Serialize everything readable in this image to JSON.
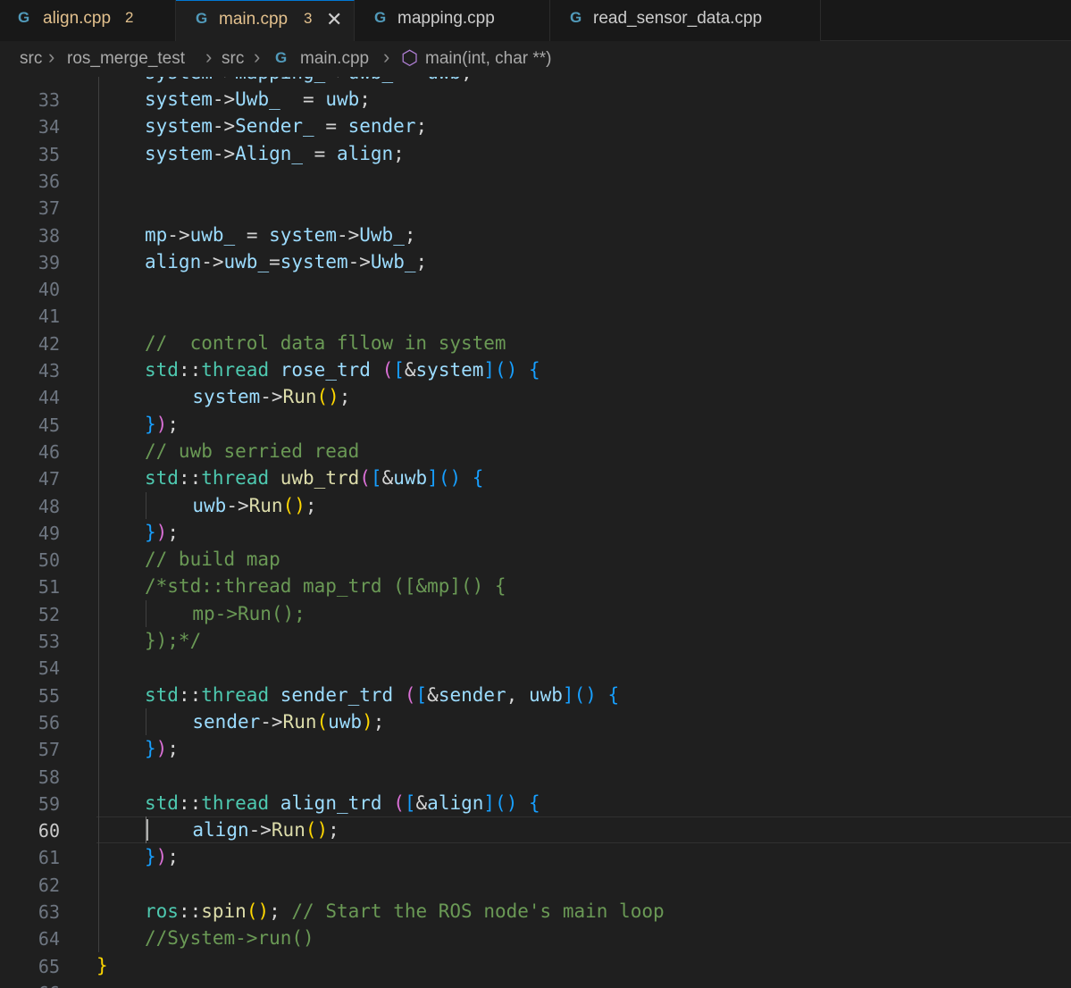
{
  "tabs": [
    {
      "label": "align.cpp",
      "badge": "2",
      "icon": "cpp-file-icon",
      "label_color": "#e2c08d"
    },
    {
      "label": "main.cpp",
      "badge": "3",
      "icon": "cpp-file-icon",
      "label_color": "#e2c08d",
      "active": true
    },
    {
      "label": "mapping.cpp",
      "badge": "",
      "icon": "cpp-file-icon",
      "label_color": "#cccccc"
    },
    {
      "label": "read_sensor_data.cpp",
      "badge": "",
      "icon": "cpp-file-icon",
      "label_color": "#cccccc"
    }
  ],
  "breadcrumb": [
    "src",
    "ros_merge_test",
    "src",
    "main.cpp",
    "main(int, char **)"
  ],
  "editor": {
    "current_line": 60,
    "lines": [
      {
        "n": "33",
        "tokens": [
          [
            "v",
            "system"
          ],
          [
            "p",
            "->"
          ],
          [
            "v",
            "Uwb_"
          ],
          [
            "p",
            "  = "
          ],
          [
            "v",
            "uwb"
          ],
          [
            "p",
            ";"
          ]
        ]
      },
      {
        "n": "34",
        "tokens": [
          [
            "v",
            "system"
          ],
          [
            "p",
            "->"
          ],
          [
            "v",
            "Sender_"
          ],
          [
            "p",
            " = "
          ],
          [
            "v",
            "sender"
          ],
          [
            "p",
            ";"
          ]
        ]
      },
      {
        "n": "35",
        "tokens": [
          [
            "v",
            "system"
          ],
          [
            "p",
            "->"
          ],
          [
            "v",
            "Align_"
          ],
          [
            "p",
            " = "
          ],
          [
            "v",
            "align"
          ],
          [
            "p",
            ";"
          ]
        ]
      },
      {
        "n": "36",
        "tokens": []
      },
      {
        "n": "37",
        "tokens": []
      },
      {
        "n": "38",
        "tokens": [
          [
            "v",
            "mp"
          ],
          [
            "p",
            "->"
          ],
          [
            "v",
            "uwb_"
          ],
          [
            "p",
            " = "
          ],
          [
            "v",
            "system"
          ],
          [
            "p",
            "->"
          ],
          [
            "v",
            "Uwb_"
          ],
          [
            "p",
            ";"
          ]
        ]
      },
      {
        "n": "39",
        "tokens": [
          [
            "v",
            "align"
          ],
          [
            "p",
            "->"
          ],
          [
            "v",
            "uwb_"
          ],
          [
            "p",
            "="
          ],
          [
            "v",
            "system"
          ],
          [
            "p",
            "->"
          ],
          [
            "v",
            "Uwb_"
          ],
          [
            "p",
            ";"
          ]
        ]
      },
      {
        "n": "40",
        "tokens": []
      },
      {
        "n": "41",
        "tokens": []
      },
      {
        "n": "42",
        "tokens": [
          [
            "c",
            "//  control data fllow in system"
          ]
        ]
      },
      {
        "n": "43",
        "tokens": [
          [
            "t",
            "std"
          ],
          [
            "p",
            "::"
          ],
          [
            "t",
            "thread"
          ],
          [
            "p",
            " "
          ],
          [
            "v",
            "rose_trd"
          ],
          [
            "p",
            " "
          ],
          [
            "b2",
            "("
          ],
          [
            "b3",
            "["
          ],
          [
            "p",
            "&"
          ],
          [
            "v",
            "system"
          ],
          [
            "b3",
            "]"
          ],
          [
            "b3",
            "()"
          ],
          [
            "p",
            " "
          ],
          [
            "b3",
            "{"
          ]
        ]
      },
      {
        "n": "44",
        "indent": 2,
        "tokens": [
          [
            "v",
            "system"
          ],
          [
            "p",
            "->"
          ],
          [
            "f",
            "Run"
          ],
          [
            "b1",
            "()"
          ],
          [
            "p",
            ";"
          ]
        ]
      },
      {
        "n": "45",
        "tokens": [
          [
            "b3",
            "}"
          ],
          [
            "b2",
            ")"
          ],
          [
            "p",
            ";"
          ]
        ]
      },
      {
        "n": "46",
        "tokens": [
          [
            "c",
            "// uwb serried read"
          ]
        ]
      },
      {
        "n": "47",
        "tokens": [
          [
            "t",
            "std"
          ],
          [
            "p",
            "::"
          ],
          [
            "t",
            "thread"
          ],
          [
            "p",
            " "
          ],
          [
            "f",
            "uwb_trd"
          ],
          [
            "b2",
            "("
          ],
          [
            "b3",
            "["
          ],
          [
            "p",
            "&"
          ],
          [
            "v",
            "uwb"
          ],
          [
            "b3",
            "]"
          ],
          [
            "b3",
            "()"
          ],
          [
            "p",
            " "
          ],
          [
            "b3",
            "{"
          ]
        ]
      },
      {
        "n": "48",
        "indent": 2,
        "tokens": [
          [
            "v",
            "uwb"
          ],
          [
            "p",
            "->"
          ],
          [
            "f",
            "Run"
          ],
          [
            "b1",
            "()"
          ],
          [
            "p",
            ";"
          ]
        ]
      },
      {
        "n": "49",
        "tokens": [
          [
            "b3",
            "}"
          ],
          [
            "b2",
            ")"
          ],
          [
            "p",
            ";"
          ]
        ]
      },
      {
        "n": "50",
        "tokens": [
          [
            "c",
            "// build map"
          ]
        ]
      },
      {
        "n": "51",
        "tokens": [
          [
            "c",
            "/*std::thread map_trd ([&mp]() {"
          ]
        ]
      },
      {
        "n": "52",
        "indent": 2,
        "tokens": [
          [
            "c",
            "mp->Run();"
          ]
        ]
      },
      {
        "n": "53",
        "tokens": [
          [
            "c",
            "});*/"
          ]
        ]
      },
      {
        "n": "54",
        "tokens": []
      },
      {
        "n": "55",
        "tokens": [
          [
            "t",
            "std"
          ],
          [
            "p",
            "::"
          ],
          [
            "t",
            "thread"
          ],
          [
            "p",
            " "
          ],
          [
            "v",
            "sender_trd"
          ],
          [
            "p",
            " "
          ],
          [
            "b2",
            "("
          ],
          [
            "b3",
            "["
          ],
          [
            "p",
            "&"
          ],
          [
            "v",
            "sender"
          ],
          [
            "p",
            ", "
          ],
          [
            "v",
            "uwb"
          ],
          [
            "b3",
            "]"
          ],
          [
            "b3",
            "()"
          ],
          [
            "p",
            " "
          ],
          [
            "b3",
            "{"
          ]
        ]
      },
      {
        "n": "56",
        "indent": 2,
        "tokens": [
          [
            "v",
            "sender"
          ],
          [
            "p",
            "->"
          ],
          [
            "f",
            "Run"
          ],
          [
            "b1",
            "("
          ],
          [
            "v",
            "uwb"
          ],
          [
            "b1",
            ")"
          ],
          [
            "p",
            ";"
          ]
        ]
      },
      {
        "n": "57",
        "tokens": [
          [
            "b3",
            "}"
          ],
          [
            "b2",
            ")"
          ],
          [
            "p",
            ";"
          ]
        ]
      },
      {
        "n": "58",
        "tokens": []
      },
      {
        "n": "59",
        "tokens": [
          [
            "t",
            "std"
          ],
          [
            "p",
            "::"
          ],
          [
            "t",
            "thread"
          ],
          [
            "p",
            " "
          ],
          [
            "v",
            "align_trd"
          ],
          [
            "p",
            " "
          ],
          [
            "b2",
            "("
          ],
          [
            "b3",
            "["
          ],
          [
            "p",
            "&"
          ],
          [
            "v",
            "align"
          ],
          [
            "b3",
            "]"
          ],
          [
            "b3",
            "()"
          ],
          [
            "p",
            " "
          ],
          [
            "b3",
            "{"
          ]
        ]
      },
      {
        "n": "60",
        "indent": 2,
        "tokens": [
          [
            "v",
            "align"
          ],
          [
            "p",
            "->"
          ],
          [
            "f",
            "Run"
          ],
          [
            "b1",
            "()"
          ],
          [
            "p",
            ";"
          ]
        ]
      },
      {
        "n": "61",
        "tokens": [
          [
            "b3",
            "}"
          ],
          [
            "b2",
            ")"
          ],
          [
            "p",
            ";"
          ]
        ]
      },
      {
        "n": "62",
        "tokens": []
      },
      {
        "n": "63",
        "tokens": [
          [
            "t",
            "ros"
          ],
          [
            "p",
            "::"
          ],
          [
            "f",
            "spin"
          ],
          [
            "b1",
            "()"
          ],
          [
            "p",
            "; "
          ],
          [
            "c",
            "// Start the ROS node's main loop"
          ]
        ]
      },
      {
        "n": "64",
        "tokens": [
          [
            "c",
            "//System->run()"
          ]
        ]
      },
      {
        "n": "65",
        "indent": -1,
        "tokens": [
          [
            "b1",
            "}"
          ]
        ]
      }
    ]
  }
}
